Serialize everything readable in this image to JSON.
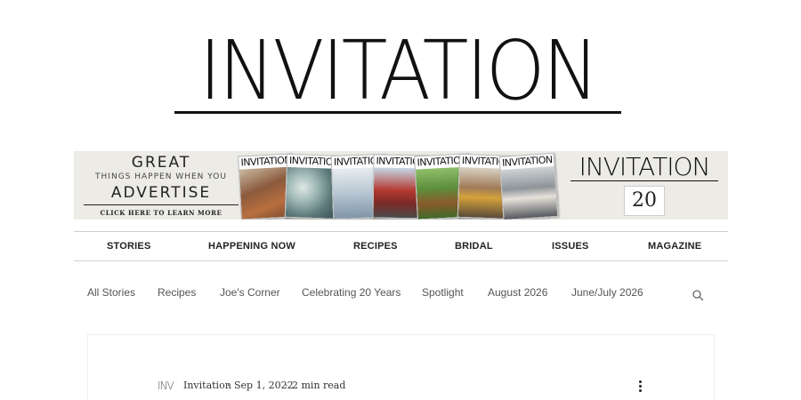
{
  "header": {
    "logo_text": "INVITATION"
  },
  "banner": {
    "headline": "GREAT",
    "subline": "THINGS HAPPEN WHEN YOU",
    "action": "ADVERTISE",
    "cta": "CLICK HERE TO LEARN MORE",
    "covers": [
      {
        "title": "INVITATION",
        "theme": "football"
      },
      {
        "title": "INVITATION",
        "theme": "oysters"
      },
      {
        "title": "INVITATION",
        "theme": "interior"
      },
      {
        "title": "INVITATION",
        "theme": "storefront"
      },
      {
        "title": "INVITATION",
        "theme": "garden"
      },
      {
        "title": "INVITATION",
        "theme": "street"
      },
      {
        "title": "INVITATION",
        "theme": "couple"
      }
    ],
    "brand": "INVITATION",
    "anniversary": "20"
  },
  "main_nav": {
    "items": [
      {
        "label": "STORIES"
      },
      {
        "label": "HAPPENING NOW"
      },
      {
        "label": "RECIPES"
      },
      {
        "label": "BRIDAL"
      },
      {
        "label": "ISSUES"
      },
      {
        "label": "MAGAZINE"
      }
    ]
  },
  "category_nav": {
    "items": [
      {
        "label": "All Stories"
      },
      {
        "label": "Recipes"
      },
      {
        "label": "Joe's Corner"
      },
      {
        "label": "Celebrating 20 Years"
      },
      {
        "label": "Spotlight"
      },
      {
        "label": "August 2026"
      },
      {
        "label": "June/July 2026"
      }
    ],
    "search_icon": "search-icon"
  },
  "post": {
    "author_logo": "INV",
    "author": "Invitation",
    "separator": "·",
    "date": "Sep 1, 2022",
    "read_time": "2 min read",
    "more_icon": "more-vertical-icon"
  },
  "colors": {
    "banner_bg": "#ecebe6",
    "text_dark": "#111111",
    "divider": "#cfcfcf",
    "category_text": "#555555"
  }
}
